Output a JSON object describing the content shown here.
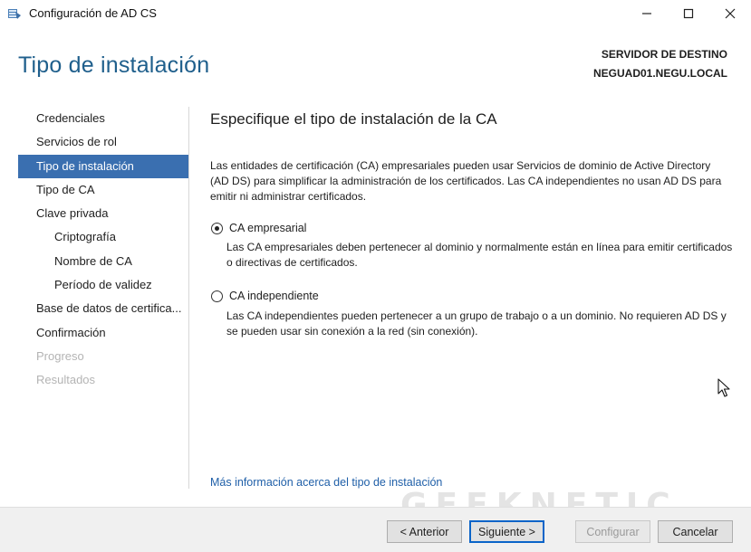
{
  "window": {
    "title": "Configuración de AD CS",
    "controls": [
      "minimize-icon",
      "maximize-icon",
      "close-icon"
    ]
  },
  "header": {
    "page_title": "Tipo de instalación",
    "destination_label": "SERVIDOR DE DESTINO",
    "destination_server": "NEGUAD01.NEGU.LOCAL"
  },
  "nav": {
    "items": [
      {
        "label": "Credenciales",
        "state": "normal"
      },
      {
        "label": "Servicios de rol",
        "state": "normal"
      },
      {
        "label": "Tipo de instalación",
        "state": "active"
      },
      {
        "label": "Tipo de CA",
        "state": "normal"
      },
      {
        "label": "Clave privada",
        "state": "normal"
      },
      {
        "label": "Criptografía",
        "state": "sub"
      },
      {
        "label": "Nombre de CA",
        "state": "sub"
      },
      {
        "label": "Período de validez",
        "state": "sub"
      },
      {
        "label": "Base de datos de certifica...",
        "state": "normal"
      },
      {
        "label": "Confirmación",
        "state": "normal"
      },
      {
        "label": "Progreso",
        "state": "disabled"
      },
      {
        "label": "Resultados",
        "state": "disabled"
      }
    ]
  },
  "content": {
    "heading": "Especifique el tipo de instalación de la CA",
    "intro": "Las entidades de certificación (CA) empresariales pueden usar Servicios de dominio de Active Directory (AD DS) para simplificar la administración de los certificados. Las CA independientes no usan AD DS para emitir ni administrar certificados.",
    "options": [
      {
        "label": "CA empresarial",
        "selected": true,
        "description": "Las CA empresariales deben pertenecer al dominio y normalmente están en línea para emitir certificados o directivas de certificados."
      },
      {
        "label": "CA independiente",
        "selected": false,
        "description": "Las CA independientes pueden pertenecer a un grupo de trabajo o a un dominio. No requieren AD DS y se pueden usar sin conexión a la red (sin conexión)."
      }
    ],
    "more_info_link": "Más información acerca del tipo de instalación"
  },
  "watermark": "GEEKNETIC",
  "footer": {
    "back": "< Anterior",
    "next": "Siguiente >",
    "configure": "Configurar",
    "cancel": "Cancelar"
  },
  "colors": {
    "title_blue": "#1f5f8c",
    "nav_active": "#3a6fb0",
    "link": "#1f5fa8",
    "disabled_text": "#b4b4b4"
  }
}
